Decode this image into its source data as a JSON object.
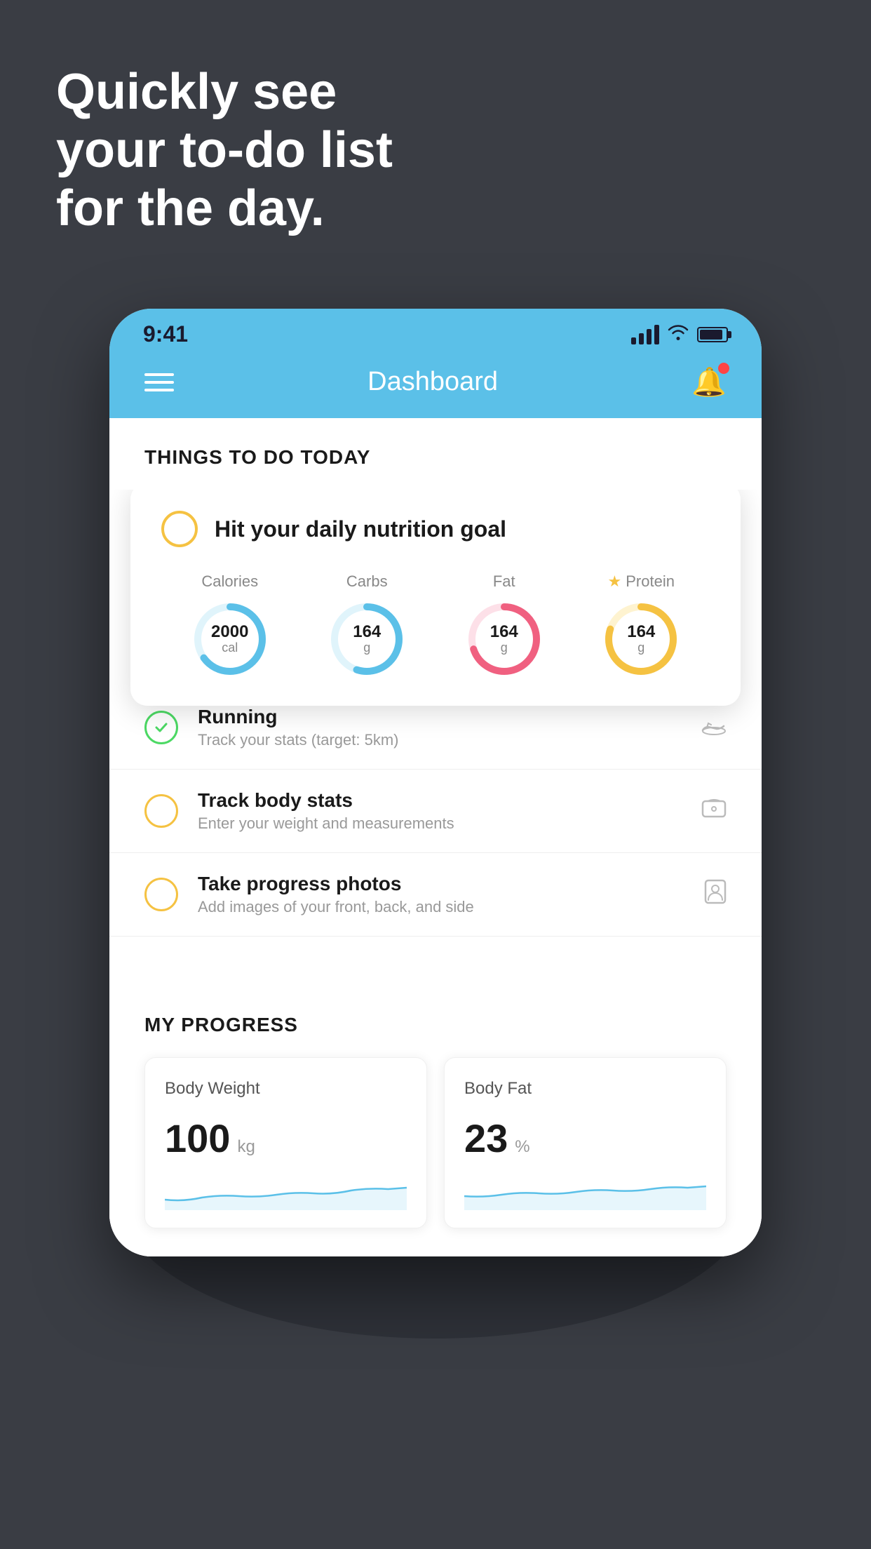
{
  "background": {
    "color": "#3a3d44"
  },
  "hero": {
    "line1": "Quickly see",
    "line2": "your to-do list",
    "line3": "for the day."
  },
  "phone": {
    "statusBar": {
      "time": "9:41"
    },
    "navBar": {
      "title": "Dashboard"
    },
    "thingsToDoHeader": "THINGS TO DO TODAY",
    "nutritionCard": {
      "circleColor": "#f5c242",
      "title": "Hit your daily nutrition goal",
      "macros": [
        {
          "label": "Calories",
          "value": "2000",
          "unit": "cal",
          "color": "#5bc0e8",
          "percent": 65
        },
        {
          "label": "Carbs",
          "value": "164",
          "unit": "g",
          "color": "#5bc0e8",
          "percent": 55
        },
        {
          "label": "Fat",
          "value": "164",
          "unit": "g",
          "color": "#f06080",
          "percent": 70
        },
        {
          "label": "Protein",
          "value": "164",
          "unit": "g",
          "color": "#f5c242",
          "percent": 80
        }
      ]
    },
    "todoItems": [
      {
        "id": "running",
        "checkColor": "green",
        "title": "Running",
        "subtitle": "Track your stats (target: 5km)",
        "icon": "shoe"
      },
      {
        "id": "body-stats",
        "checkColor": "yellow",
        "title": "Track body stats",
        "subtitle": "Enter your weight and measurements",
        "icon": "scale"
      },
      {
        "id": "progress-photos",
        "checkColor": "yellow",
        "title": "Take progress photos",
        "subtitle": "Add images of your front, back, and side",
        "icon": "person"
      }
    ],
    "progressSection": {
      "header": "MY PROGRESS",
      "cards": [
        {
          "title": "Body Weight",
          "value": "100",
          "unit": "kg"
        },
        {
          "title": "Body Fat",
          "value": "23",
          "unit": "%"
        }
      ]
    }
  }
}
